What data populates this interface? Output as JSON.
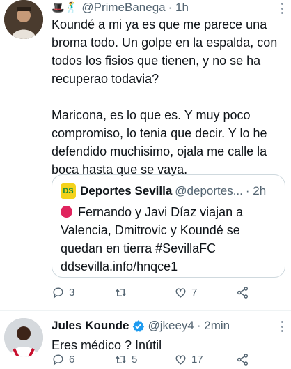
{
  "tweets": [
    {
      "emoji": "🎩🕺",
      "handle": "@PrimeBanega",
      "time": "· 1h",
      "text": "Koundé a mi ya es que me parece una broma todo. Un golpe en la espalda, con todos los fisios que tienen, y no se ha recuperao todavia?\n\nMaricona, es lo que es. Y muy poco compromiso, lo tenia que decir. Y lo he defendido muchisimo, ojala me calle la boca hasta que se vaya.",
      "quote": {
        "logo": "DS",
        "name": "Deportes Sevilla",
        "handle": "@deportes...",
        "time": "· 2h",
        "text": "Fernando y Javi Díaz viajan a Valencia, Dmitrovic y Koundé se quedan en tierra #SevillaFC ddsevilla.info/hnqce1"
      },
      "actions": {
        "replies": "3",
        "retweets": "",
        "likes": "7"
      }
    },
    {
      "name": "Jules Kounde",
      "handle": "@jkeey4",
      "time": "· 2min",
      "text": "Eres médico ? Inútil",
      "actions": {
        "replies": "6",
        "retweets": "5",
        "likes": "17"
      }
    }
  ],
  "colors": {
    "verified": "#1d9bf0",
    "muted": "#536471",
    "quote_dot": "#e0245e"
  },
  "icons": [
    "more-icon",
    "reply-icon",
    "retweet-icon",
    "like-icon",
    "share-icon",
    "verified-icon"
  ]
}
